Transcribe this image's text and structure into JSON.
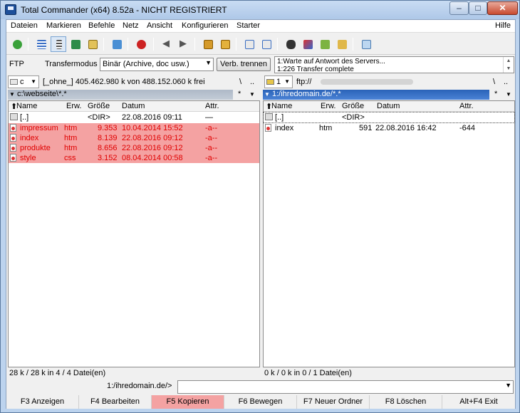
{
  "window": {
    "title": "Total Commander (x64) 8.52a - NICHT REGISTRIERT"
  },
  "menu": [
    "Dateien",
    "Markieren",
    "Befehle",
    "Netz",
    "Ansicht",
    "Konfigurieren",
    "Starter"
  ],
  "menu_help": "Hilfe",
  "toolbar_icons": [
    "refresh-icon",
    "brief-view-icon",
    "detailed-view-icon",
    "thumbnail-view-icon",
    "tree-icon",
    "invert-selection-icon",
    "back-icon",
    "forward-icon",
    "pack-icon",
    "unpack-icon",
    "ftp-connect-icon",
    "ftp-new-connection-icon",
    "search-icon",
    "rename-tool-icon",
    "sync-dirs-icon",
    "notepad-icon",
    "copy-names-icon"
  ],
  "ftp": {
    "label": "FTP",
    "mode_label": "Transfermodus",
    "mode_value": "Binär (Archive, doc usw.)",
    "disconnect_label": "Verb. trennen",
    "log_line1": "1:Warte auf Antwort des Servers...",
    "log_line2": "1:226 Transfer complete"
  },
  "left": {
    "drive": "c",
    "volume_info": "[_ohne_]  405.462.980 k von 488.152.060 k frei",
    "path": "c:\\webseite\\*.*",
    "backslash": "\\",
    "dotdot": "..",
    "star": "*",
    "headers": [
      "Name",
      "Erw.",
      "Größe",
      "Datum",
      "Attr."
    ],
    "rows": [
      {
        "name": "[..]",
        "ext": "",
        "size": "<DIR>",
        "date": "22.08.2016 09:11",
        "attr": "—",
        "selected": false
      },
      {
        "name": "impressum",
        "ext": "htm",
        "size": "9.353",
        "date": "10.04.2014 15:52",
        "attr": "-a--",
        "selected": true
      },
      {
        "name": "index",
        "ext": "htm",
        "size": "8.139",
        "date": "22.08.2016 09:12",
        "attr": "-a--",
        "selected": true
      },
      {
        "name": "produkte",
        "ext": "htm",
        "size": "8.656",
        "date": "22.08.2016 09:12",
        "attr": "-a--",
        "selected": true
      },
      {
        "name": "style",
        "ext": "css",
        "size": "3.152",
        "date": "08.04.2014 00:58",
        "attr": "-a--",
        "selected": true
      }
    ],
    "status": "28 k / 28 k in 4 / 4 Datei(en)"
  },
  "right": {
    "drive": "1",
    "volume_info": "ftp://",
    "path": "1:/ihredomain.de/*.*",
    "backslash": "\\",
    "dotdot": "..",
    "star": "*",
    "headers": [
      "Name",
      "Erw.",
      "Größe",
      "Datum",
      "Attr."
    ],
    "rows": [
      {
        "name": "[..]",
        "ext": "",
        "size": "<DIR>",
        "date": "",
        "attr": ""
      },
      {
        "name": "index",
        "ext": "htm",
        "size": "591",
        "date": "22.08.2016 16:42",
        "attr": "-644"
      }
    ],
    "status": "0 k / 0 k in 0 / 1 Datei(en)"
  },
  "cmdline": {
    "prompt": "1:/ihredomain.de/>"
  },
  "fkeys": [
    "F3 Anzeigen",
    "F4 Bearbeiten",
    "F5 Kopieren",
    "F6 Bewegen",
    "F7 Neuer Ordner",
    "F8 Löschen",
    "Alt+F4 Exit"
  ],
  "colors": {
    "selection": "#f4a2a2",
    "selected_text": "#e00000",
    "active_path": "#2a63b8"
  }
}
